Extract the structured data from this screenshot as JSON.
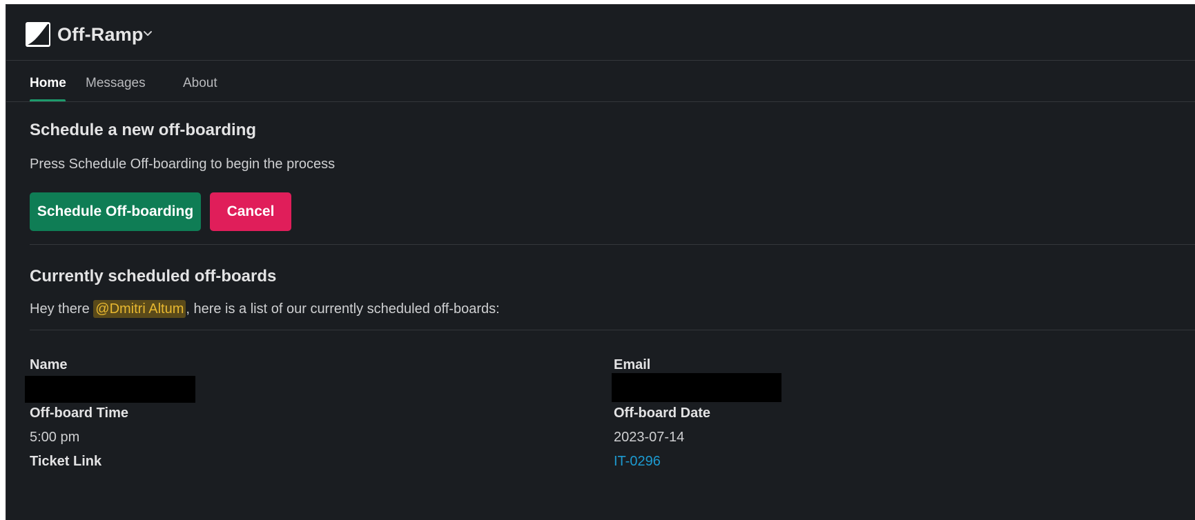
{
  "app": {
    "title": "Off-Ramp",
    "logo_icon": "off-ramp-logo-icon",
    "title_menu_icon": "chevron-down-icon"
  },
  "tabs": [
    {
      "label": "Home",
      "active": true
    },
    {
      "label": "Messages",
      "active": false
    },
    {
      "label": "About",
      "active": false
    }
  ],
  "schedule_section": {
    "heading": "Schedule a new off-boarding",
    "description": "Press Schedule Off-boarding to begin the process",
    "primary_button": "Schedule Off-boarding",
    "cancel_button": "Cancel"
  },
  "current_section": {
    "heading": "Currently scheduled off-boards",
    "intro_before": "Hey there ",
    "mention": "@Dmitri Altum",
    "intro_after": ", here is a list of our currently scheduled off-boards:"
  },
  "record": {
    "name_label": "Name",
    "email_label": "Email",
    "time_label": "Off-board Time",
    "time_value": "5:00 pm",
    "date_label": "Off-board Date",
    "date_value": "2023-07-14",
    "ticket_label": "Ticket Link",
    "ticket_value": "IT-0296"
  },
  "colors": {
    "background": "#1a1d21",
    "primary_button": "#0f7d55",
    "cancel_button": "#e01e5a",
    "tab_accent": "#1d9b6c",
    "mention_text": "#e8b830",
    "link": "#1d9bd1"
  }
}
